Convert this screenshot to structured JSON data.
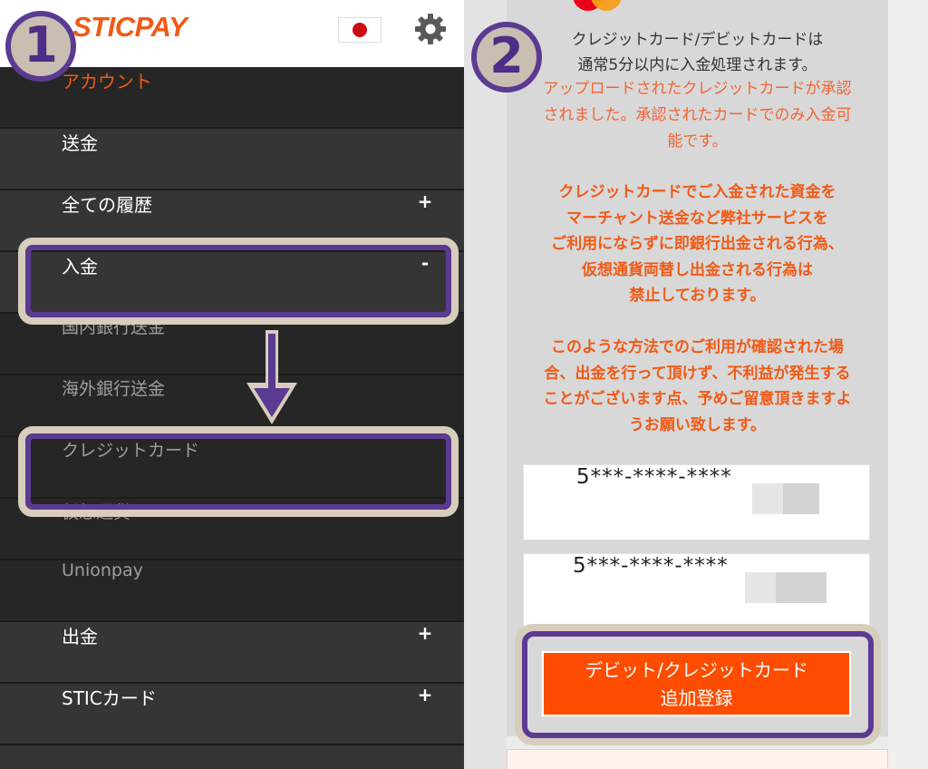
{
  "left": {
    "logo": "STICPAY",
    "menu": [
      {
        "label": "アカウント",
        "kind": "account",
        "toggle": ""
      },
      {
        "label": "送金",
        "kind": "primary",
        "toggle": ""
      },
      {
        "label": "全ての履歴",
        "kind": "primary",
        "toggle": "+"
      },
      {
        "label": "入金",
        "kind": "primary",
        "toggle": "-"
      },
      {
        "label": "国内銀行送金",
        "kind": "sub",
        "toggle": ""
      },
      {
        "label": "海外銀行送金",
        "kind": "sub",
        "toggle": ""
      },
      {
        "label": "クレジットカード",
        "kind": "sub",
        "toggle": ""
      },
      {
        "label": "仮想通貨",
        "kind": "sub",
        "toggle": ""
      },
      {
        "label": "Unionpay",
        "kind": "sub",
        "toggle": ""
      },
      {
        "label": "出金",
        "kind": "primary",
        "toggle": "+"
      },
      {
        "label": "STICカード",
        "kind": "primary",
        "toggle": "+"
      }
    ]
  },
  "right": {
    "info_lines": [
      "クレジットカード/デビットカードは",
      "通常5分以内に入金処理されます。"
    ],
    "approved_lines": [
      "アップロードされたクレジットカードが承認",
      "されました。承認されたカードでのみ入金可",
      "能です。"
    ],
    "warning1_lines": [
      "クレジットカードでご入金された資金を",
      "マーチャント送金など弊社サービスを",
      "ご利用にならずに即銀行出金される行為、",
      "仮想通貨両替し出金される行為は",
      "禁止しております。"
    ],
    "warning2_lines": [
      "このような方法でのご利用が確認された場",
      "合、出金を行って頂けず、不利益が発生する",
      "ことがございます点、予めご留意頂きますよ",
      "うお願い致します。"
    ],
    "cards": [
      "5***-****-****",
      "5***-****-****"
    ],
    "add_button_lines": [
      "デビット/クレジットカード",
      "追加登録"
    ]
  },
  "annotations": {
    "step1": "1",
    "step2": "2"
  },
  "colors": {
    "brand_orange": "#f15a16",
    "button_orange": "#fe4c00",
    "highlight_purple": "#5b3a92",
    "highlight_beige": "#d7cdbd"
  }
}
